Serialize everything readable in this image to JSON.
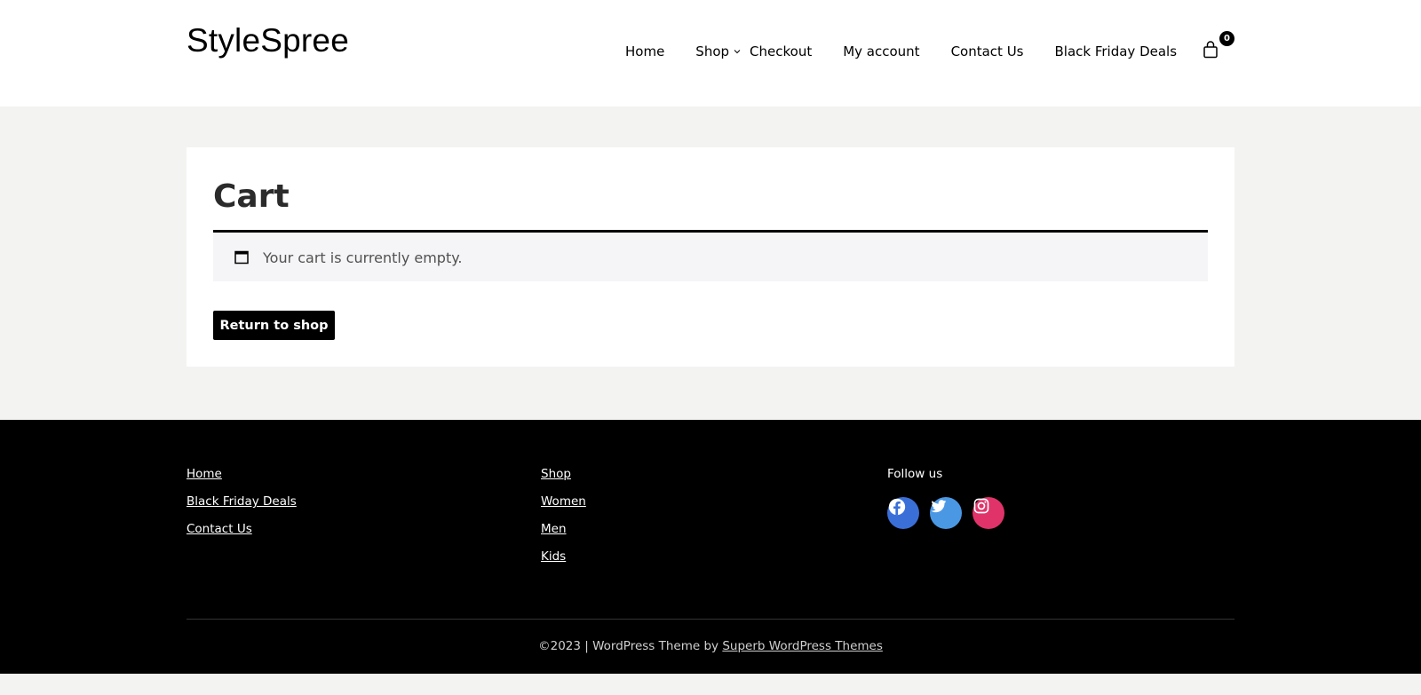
{
  "header": {
    "site_title": "StyleSpree",
    "nav": {
      "home": "Home",
      "shop": "Shop",
      "checkout": "Checkout",
      "my_account": "My account",
      "contact": "Contact Us",
      "black_friday": "Black Friday Deals"
    },
    "cart_count": "0"
  },
  "main": {
    "page_title": "Cart",
    "notice_text": "Your cart is currently empty.",
    "return_button": "Return to shop"
  },
  "footer": {
    "col1": [
      "Home",
      "Black Friday Deals",
      "Contact Us"
    ],
    "col2": [
      "Shop",
      "Women",
      "Men",
      "Kids"
    ],
    "follow_title": "Follow us",
    "social": [
      "facebook-icon",
      "twitter-icon",
      "instagram-icon"
    ],
    "credit_prefix": "©2023 | WordPress Theme by ",
    "credit_link": "Superb WordPress Themes"
  },
  "colors": {
    "page_bg": "#f3f4f1",
    "footer_bg": "#000000",
    "facebook": "#3b6fd8",
    "twitter": "#4a98e4",
    "instagram": "#e0336a"
  }
}
